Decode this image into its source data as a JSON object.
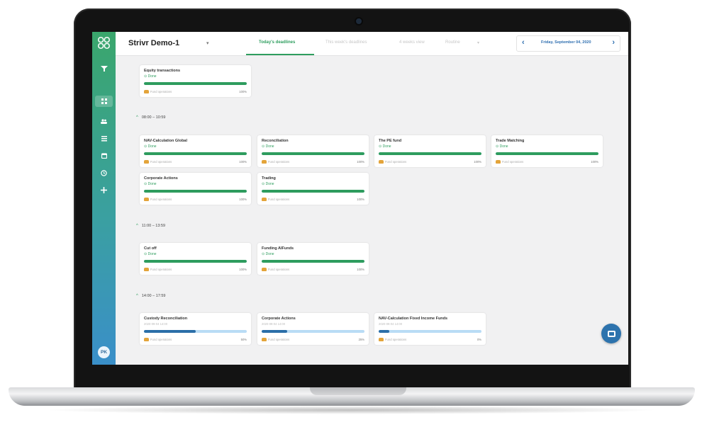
{
  "app": {
    "title": "Strivr Demo-1",
    "title_caret": "▾"
  },
  "tabs": [
    {
      "label": "Today's deadlines"
    },
    {
      "label": "This week's deadlines"
    },
    {
      "label": "4 weeks view"
    },
    {
      "label": "Routine"
    }
  ],
  "tab_dropdown": "▾",
  "date_picker": {
    "prev": "‹",
    "label": "Friday, September 04, 2020",
    "next": "›"
  },
  "sidebar": {
    "avatar": "PK",
    "icons": [
      "filter-icon",
      "dashboard-icon",
      "users-icon",
      "list-icon",
      "calendar-icon",
      "clock-icon",
      "plus-icon"
    ]
  },
  "sections": [
    {
      "label": "08:00 – 10:59",
      "chevron": "^"
    },
    {
      "label": "11:00 – 13:59",
      "chevron": "^"
    },
    {
      "label": "14:00 – 17:59",
      "chevron": "^"
    }
  ],
  "cards": {
    "top": [
      {
        "title": "Equity transactions",
        "status": "⊙ Done",
        "owner": "Fund operations",
        "percent": "100%",
        "progress": 1.0
      }
    ],
    "s1": [
      {
        "title": "NAV-Calculation Global",
        "status": "⊙ Done",
        "owner": "Fund operations",
        "percent": "100%",
        "progress": 1.0
      },
      {
        "title": "Reconciliation",
        "status": "⊙ Done",
        "owner": "Fund operations",
        "percent": "100%",
        "progress": 1.0
      },
      {
        "title": "The PE fund",
        "status": "⊙ Done",
        "owner": "Fund operations",
        "percent": "100%",
        "progress": 1.0
      },
      {
        "title": "Trade Matching",
        "status": "⊙ Done",
        "owner": "Fund operations",
        "percent": "100%",
        "progress": 1.0
      },
      {
        "title": "Corporate Actions",
        "status": "⊙ Done",
        "owner": "Fund operations",
        "percent": "100%",
        "progress": 1.0
      },
      {
        "title": "Trading",
        "status": "⊙ Done",
        "owner": "Fund operations",
        "percent": "100%",
        "progress": 1.0
      }
    ],
    "s2": [
      {
        "title": "Cut off",
        "status": "⊙ Done",
        "owner": "Fund operations",
        "percent": "100%",
        "progress": 1.0
      },
      {
        "title": "Funding AIFunds",
        "status": "⊙ Done",
        "owner": "Fund operations",
        "percent": "100%",
        "progress": 1.0
      }
    ],
    "s3": [
      {
        "title": "Custody Reconciliation",
        "date": "2020-09-04 14:00",
        "owner": "Fund operations",
        "percent": "50%",
        "progress": 0.5
      },
      {
        "title": "Corporate Actions",
        "date": "2020-09-04 14:00",
        "owner": "Fund operations",
        "percent": "25%",
        "progress": 0.25
      },
      {
        "title": "NAV-Calculation Fixed Income Funds",
        "date": "2020-09-04 14:00",
        "owner": "Fund operations",
        "percent": "0%",
        "progress": 0.1
      }
    ]
  }
}
